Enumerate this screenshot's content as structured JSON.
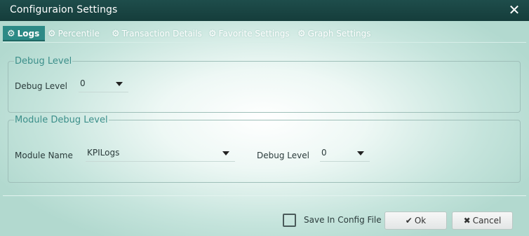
{
  "dialog": {
    "title": "Configuraion Settings",
    "close_icon": "✕"
  },
  "tabs": [
    {
      "label": "Logs",
      "icon": "gear-icon",
      "active": true
    },
    {
      "label": "Percentile",
      "icon": "gear-icon",
      "active": false
    },
    {
      "label": "Transaction Details",
      "icon": "gear-icon",
      "active": false
    },
    {
      "label": "Favorite Settings",
      "icon": "gear-icon",
      "active": false
    },
    {
      "label": "Graph Settings",
      "icon": "gear-icon",
      "active": false
    }
  ],
  "debug_level_group": {
    "legend": "Debug Level",
    "label": "Debug Level",
    "value": "0"
  },
  "module_group": {
    "legend": "Module Debug Level",
    "module_label": "Module Name",
    "module_value": "KPILogs",
    "debug_label": "Debug Level",
    "debug_value": "0"
  },
  "footer": {
    "save_config_label": "Save In Config File",
    "save_config_checked": false,
    "ok_label": "Ok",
    "cancel_label": "Cancel"
  },
  "colors": {
    "titlebar": "#1b4745",
    "active_tab": "#2c8a86",
    "legend": "#3c8f8a"
  }
}
